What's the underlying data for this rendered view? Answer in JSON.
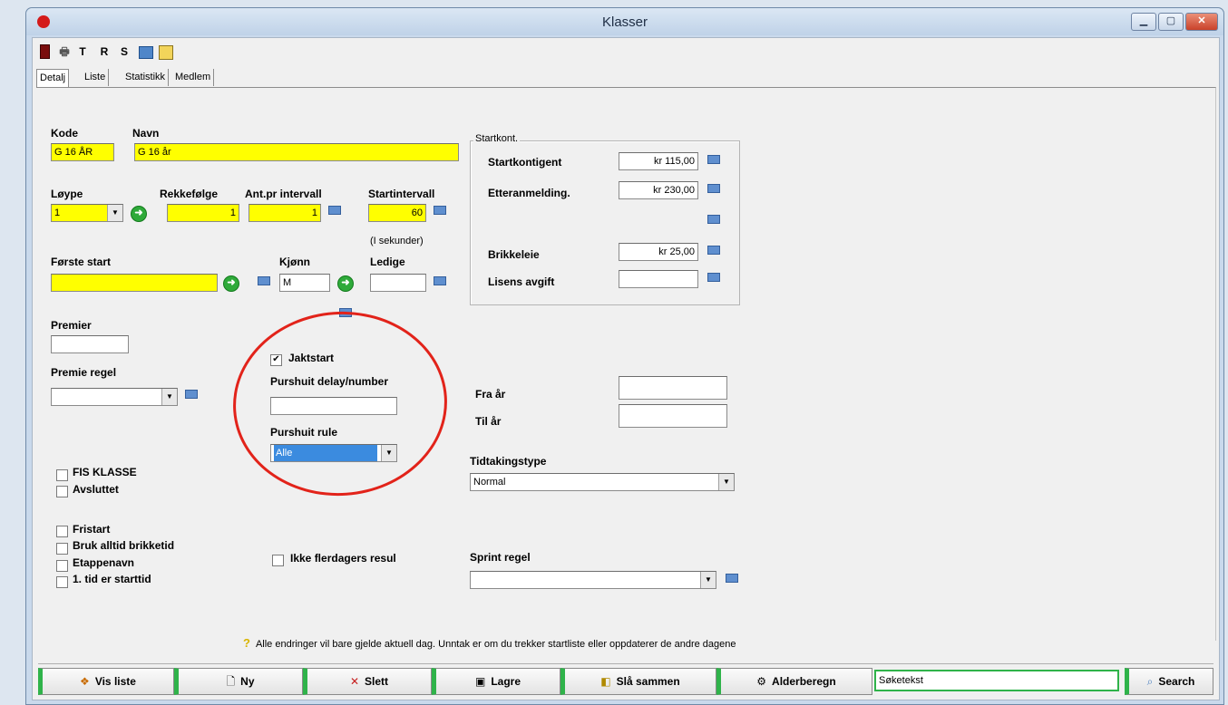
{
  "window": {
    "title": "Klasser",
    "minimize": "▁",
    "maximize": "▢",
    "close": "✕"
  },
  "toolbar": {
    "t_label": "T",
    "r_label": "R",
    "s_label": "S"
  },
  "tabs": [
    {
      "label": "Detalj",
      "active": true
    },
    {
      "label": "Liste"
    },
    {
      "label": "Statistikk"
    },
    {
      "label": "Medlem"
    }
  ],
  "form": {
    "kode_label": "Kode",
    "kode_value": "G 16 ÅR",
    "navn_label": "Navn",
    "navn_value": "G 16 år",
    "loype_label": "Løype",
    "loype_value": "1",
    "rekkefolge_label": "Rekkefølge",
    "rekkefolge_value": "1",
    "ant_pr_intervall_label": "Ant.pr intervall",
    "ant_pr_intervall_value": "1",
    "startintervall_label": "Startintervall",
    "startintervall_value": "60",
    "startintervall_note": "(I sekunder)",
    "forste_start_label": "Første start",
    "forste_start_value": "",
    "kjonn_label": "Kjønn",
    "kjonn_value": "M",
    "ledige_label": "Ledige",
    "ledige_value": "",
    "premier_label": "Premier",
    "premier_value": "",
    "premie_regel_label": "Premie regel",
    "premie_regel_value": "",
    "jaktstart_label": "Jaktstart",
    "jaktstart_checked": true,
    "purshuit_delay_label": "Purshuit delay/number",
    "purshuit_delay_value": "",
    "purshuit_rule_label": "Purshuit rule",
    "purshuit_rule_value": "Alle",
    "fra_ar_label": "Fra år",
    "fra_ar_value": "",
    "til_ar_label": "Til år",
    "til_ar_value": "",
    "tidtakingstype_label": "Tidtakingstype",
    "tidtakingstype_value": "Normal",
    "sprint_regel_label": "Sprint regel",
    "sprint_regel_value": "",
    "checkboxes": {
      "fis_klasse": "FIS KLASSE",
      "avsluttet": "Avsluttet",
      "fristart": "Fristart",
      "bruk_alltid_brikketid": "Bruk alltid brikketid",
      "etappenavn": "Etappenavn",
      "forste_tid_starttid": "1. tid er starttid",
      "ikke_flerdagers": "Ikke flerdagers resul"
    }
  },
  "startkont": {
    "group_label": "Startkont.",
    "startkontigent_label": "Startkontigent",
    "startkontigent_value": "kr 115,00",
    "etteranmelding_label": "Etteranmelding.",
    "etteranmelding_value": "kr 230,00",
    "brikkeleie_label": "Brikkeleie",
    "brikkeleie_value": "kr 25,00",
    "lisens_label": "Lisens avgift",
    "lisens_value": ""
  },
  "hint": {
    "icon": "?",
    "text": "Alle endringer vil bare gjelde aktuell dag. Unntak er om du trekker startliste eller oppdaterer de andre dagene"
  },
  "buttons": {
    "vis_liste": "Vis liste",
    "ny": "Ny",
    "slett": "Slett",
    "lagre": "Lagre",
    "sla_sammen": "Slå sammen",
    "alderberegn": "Alderberegn",
    "search_text": "Søketekst",
    "search": "Search"
  },
  "colors": {
    "required_field": "#ffff00",
    "accent_green": "#2fb34a",
    "annotation_red": "#e2231a"
  }
}
